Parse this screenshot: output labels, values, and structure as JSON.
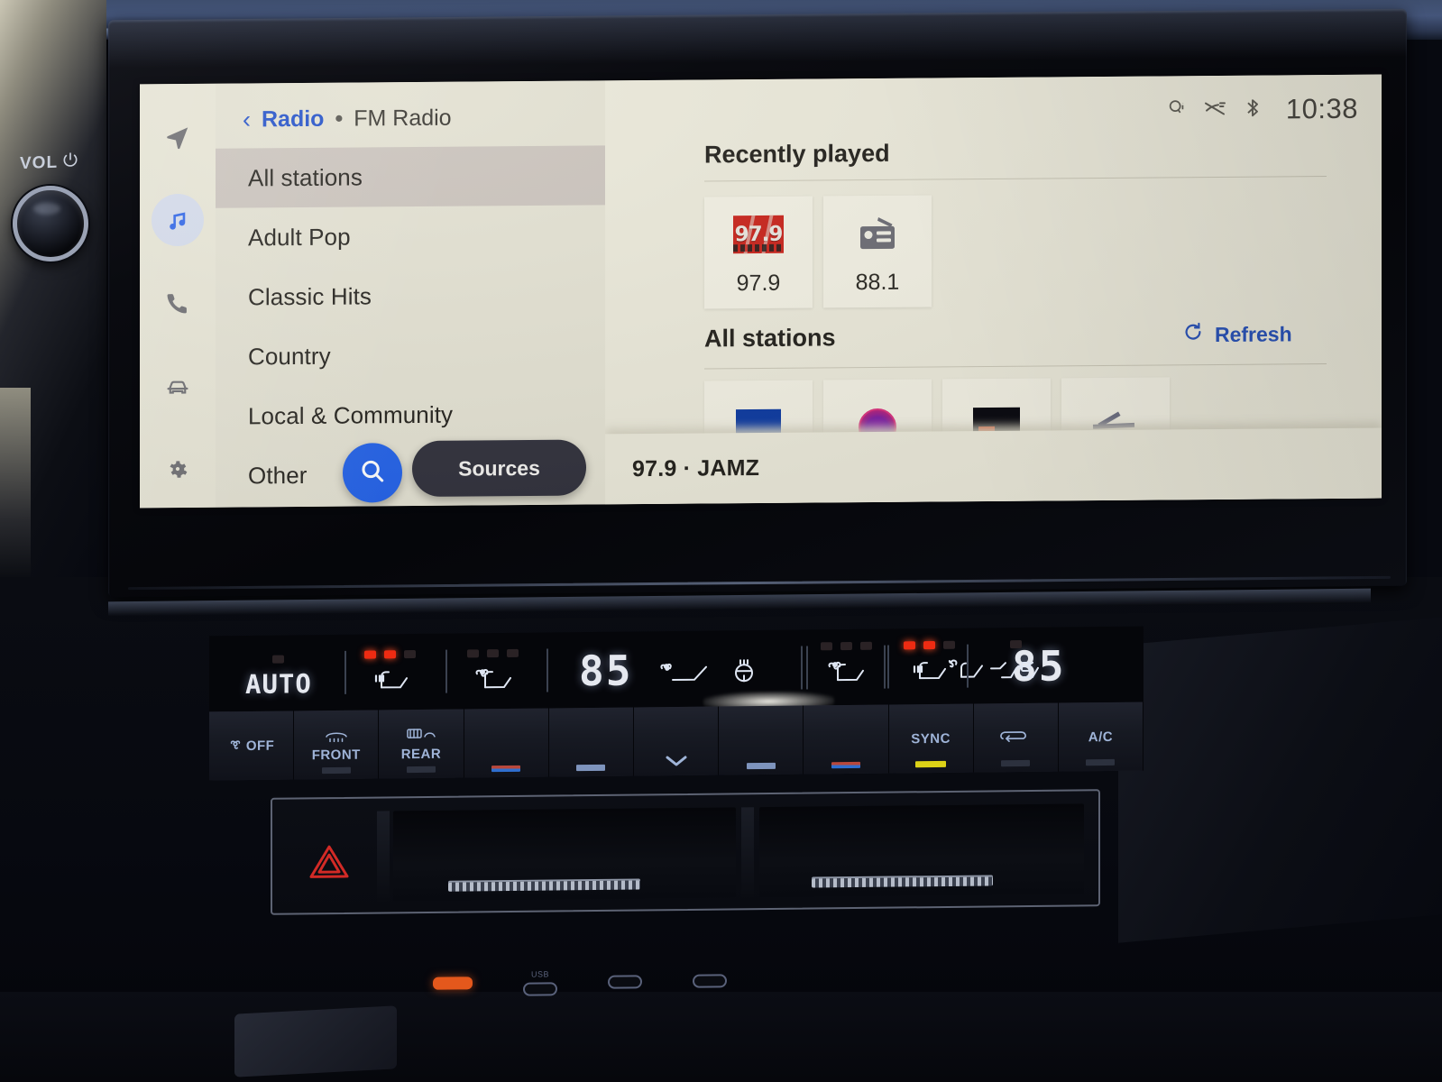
{
  "hardware": {
    "vol_label": "VOL",
    "power_icon": "power-icon",
    "knob": "volume-knob"
  },
  "screen": {
    "breadcrumb": {
      "back_icon": "chevron-left-icon",
      "parent": "Radio",
      "separator": "•",
      "current": "FM Radio"
    },
    "rail": [
      {
        "name": "navigation-icon",
        "label": "Navigation",
        "active": false
      },
      {
        "name": "music-note-icon",
        "label": "Media",
        "active": true
      },
      {
        "name": "phone-icon",
        "label": "Phone",
        "active": false
      },
      {
        "name": "car-icon",
        "label": "Vehicle",
        "active": false
      },
      {
        "name": "gear-icon",
        "label": "Settings",
        "active": false
      }
    ],
    "categories": [
      {
        "label": "All stations",
        "selected": true
      },
      {
        "label": "Adult Pop",
        "selected": false
      },
      {
        "label": "Classic Hits",
        "selected": false
      },
      {
        "label": "Country",
        "selected": false
      },
      {
        "label": "Local & Community",
        "selected": false
      },
      {
        "label": "Other",
        "selected": false
      }
    ],
    "search_button": {
      "icon": "search-icon",
      "label": "Search"
    },
    "sources_button": {
      "label": "Sources"
    },
    "status": {
      "qi_icon": "qi-wireless-charging-icon",
      "mute_icon": "media-muted-icon",
      "bluetooth_icon": "bluetooth-icon",
      "time": "10:38"
    },
    "recently_played": {
      "title": "Recently played",
      "items": [
        {
          "label": "97.9",
          "art": "jamz-logo",
          "art_text": "97.9"
        },
        {
          "label": "88.1",
          "art": "radio-icon"
        }
      ]
    },
    "all_stations": {
      "title": "All stations",
      "refresh": {
        "icon": "refresh-icon",
        "label": "Refresh"
      },
      "tiles": [
        {
          "art": "logo-blue"
        },
        {
          "art": "logo-purple"
        },
        {
          "art": "logo-black"
        },
        {
          "art": "logo-gray"
        }
      ]
    },
    "now_playing": {
      "text": "97.9 · JAMZ"
    },
    "colors": {
      "accent_blue": "#2563e8",
      "link_blue": "#2250c8",
      "panel_bg": "#eae8d9",
      "list_bg": "#e3e1d2",
      "selected_row": "#cbc4bd",
      "pill_dark": "#32323d"
    }
  },
  "climate": {
    "driver_temp": "85",
    "passenger_temp": "85",
    "buttons": [
      {
        "label": "AUTO",
        "type": "display"
      },
      {
        "label": "",
        "type": "display",
        "icon": "heated-seat-icon",
        "leds": [
          "on",
          "on",
          "off"
        ]
      },
      {
        "label": "",
        "type": "display",
        "icon": "ventilated-seat-icon",
        "leds": [
          "off",
          "off",
          "off"
        ]
      },
      {
        "label": "",
        "type": "display",
        "icon": "defrost-seat-icon"
      }
    ],
    "row_buttons": [
      {
        "label": "OFF",
        "icon": "fan-off-icon",
        "pip": "none"
      },
      {
        "label": "FRONT",
        "icon": "front-defrost-icon",
        "pip": "dark"
      },
      {
        "label": "REAR",
        "icon": "rear-defrost-icon",
        "pip": "dark"
      },
      {
        "label": "",
        "icon": "temp-driver-icon",
        "pip": "redblue"
      },
      {
        "label": "",
        "icon": "fan-up-icon",
        "pip": "plain"
      },
      {
        "label": "",
        "icon": "mode-icon",
        "pip": "chevron"
      },
      {
        "label": "",
        "icon": "fan-down-icon",
        "pip": "plain"
      },
      {
        "label": "",
        "icon": "temp-passenger-icon",
        "pip": "redblue"
      },
      {
        "label": "SYNC",
        "icon": "sync-icon",
        "pip": "yellow"
      },
      {
        "label": "",
        "icon": "recirculate-icon",
        "pip": "dark"
      },
      {
        "label": "A/C",
        "icon": "ac-icon",
        "pip": "dark"
      }
    ],
    "right_display": {
      "vent_seat_icon": "ventilated-seat-icon",
      "heated_seat_icon": "heated-seat-icon",
      "heated_leds": [
        "on",
        "on",
        "off"
      ],
      "rear_climate_icon": "rear-seat-climate-icon"
    }
  },
  "console": {
    "hazard_icon": "hazard-triangle-icon",
    "usb_ports": [
      "usb-c-port",
      "usb-c-port"
    ],
    "usb_label": "USB"
  }
}
